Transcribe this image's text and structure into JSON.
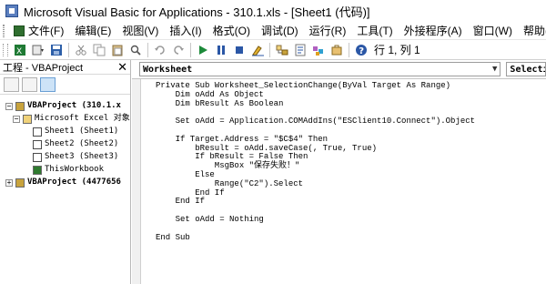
{
  "window": {
    "title": "Microsoft Visual Basic for Applications - 310.1.xls - [Sheet1 (代码)]"
  },
  "menu": {
    "items": [
      "文件(F)",
      "编辑(E)",
      "视图(V)",
      "插入(I)",
      "格式(O)",
      "调试(D)",
      "运行(R)",
      "工具(T)",
      "外接程序(A)",
      "窗口(W)",
      "帮助(H)"
    ]
  },
  "toolbar": {
    "status": "行 1, 列 1",
    "icons": [
      "excel-icon",
      "insert-icon",
      "save-icon",
      "cut-icon",
      "copy-icon",
      "paste-icon",
      "find-icon",
      "undo-icon",
      "redo-icon",
      "run-icon",
      "break-icon",
      "reset-icon",
      "design-mode-icon",
      "project-explorer-icon",
      "properties-icon",
      "object-browser-icon",
      "toolbox-icon",
      "help-icon"
    ]
  },
  "project_panel": {
    "title": "工程 - VBAProject",
    "close": "✕",
    "tree": [
      {
        "label": "VBAProject (310.1.x",
        "icon": "project-icon",
        "expander": "−",
        "bold": true
      },
      {
        "label": "Microsoft Excel 对象",
        "icon": "folder-icon",
        "expander": "−",
        "bold": false
      },
      {
        "label": "Sheet1 (Sheet1)",
        "icon": "sheet-icon",
        "expander": "",
        "bold": false
      },
      {
        "label": "Sheet2 (Sheet2)",
        "icon": "sheet-icon",
        "expander": "",
        "bold": false
      },
      {
        "label": "Sheet3 (Sheet3)",
        "icon": "sheet-icon",
        "expander": "",
        "bold": false
      },
      {
        "label": "ThisWorkbook",
        "icon": "workbook-icon",
        "expander": "",
        "bold": false
      },
      {
        "label": "VBAProject (4477656",
        "icon": "project-icon",
        "expander": "+",
        "bold": true
      }
    ]
  },
  "code_window": {
    "object_combo": "Worksheet",
    "procedure_combo": "Selectio",
    "lines": [
      "Private Sub Worksheet_SelectionChange(ByVal Target As Range)",
      "    Dim oAdd As Object",
      "    Dim bResult As Boolean",
      "",
      "    Set oAdd = Application.COMAddIns(\"ESClient10.Connect\").Object",
      "",
      "    If Target.Address = \"$C$4\" Then",
      "        bResult = oAdd.saveCase(, True, True)",
      "        If bResult = False Then",
      "            MsgBox \"保存失败！\"",
      "        Else",
      "            Range(\"C2\").Select",
      "        End If",
      "    End If",
      "",
      "    Set oAdd = Nothing",
      "",
      "End Sub"
    ]
  }
}
